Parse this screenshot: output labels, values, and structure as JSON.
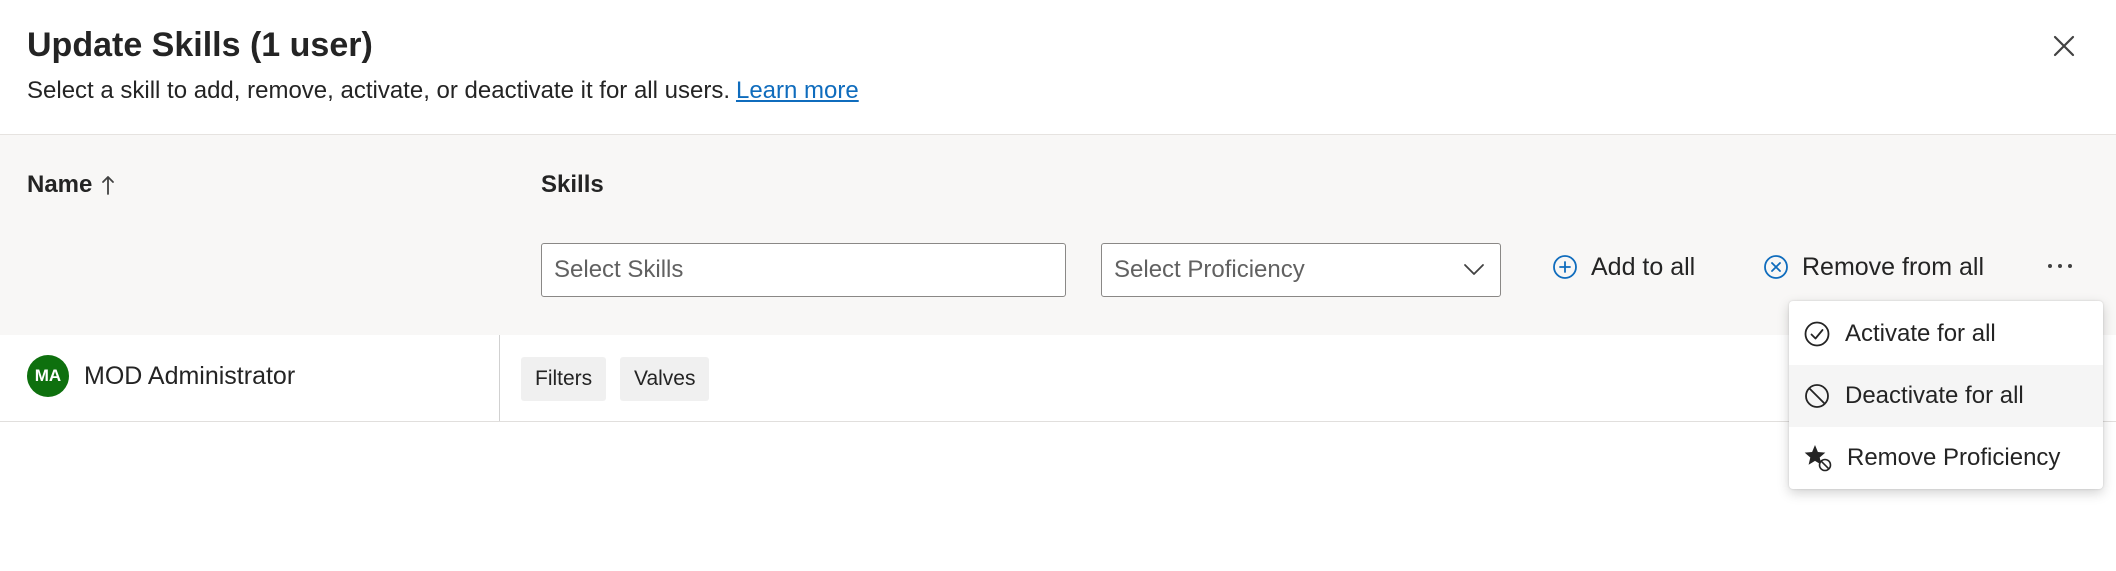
{
  "dialog": {
    "title": "Update Skills (1 user)",
    "subtitle": "Select a skill to add, remove, activate, or deactivate it for all users.",
    "learn_more": "Learn more",
    "close_icon": "close-icon"
  },
  "columns": {
    "name": "Name",
    "name_sort_icon": "arrow-up-icon",
    "skills": "Skills"
  },
  "toolbar": {
    "skills_placeholder": "Select Skills",
    "proficiency_placeholder": "Select Proficiency",
    "add_to_all": "Add to all",
    "remove_from_all": "Remove from all",
    "more_icon": "more-horizontal-icon"
  },
  "rows": [
    {
      "initials": "MA",
      "name": "MOD Administrator",
      "skills": [
        "Filters",
        "Valves"
      ]
    }
  ],
  "menu": {
    "items": [
      {
        "label": "Activate for all",
        "icon": "checkmark-circle-icon"
      },
      {
        "label": "Deactivate for all",
        "icon": "prohibited-icon"
      },
      {
        "label": "Remove Proficiency",
        "icon": "star-prohibited-icon"
      }
    ]
  },
  "colors": {
    "accent": "#0f6cbd",
    "avatar": "#0e700e",
    "header_band": "#f8f7f6"
  }
}
